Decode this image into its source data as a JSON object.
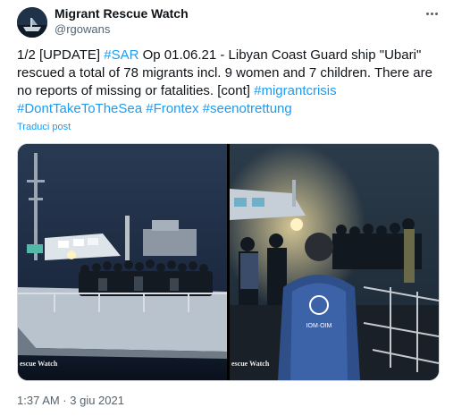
{
  "author": {
    "name": "Migrant Rescue Watch",
    "handle": "@rgowans",
    "avatar_icon": "boat-avatar-icon"
  },
  "post": {
    "text_plain_1": "1/2 [UPDATE] ",
    "tag_sar": "#SAR",
    "text_plain_2": " Op 01.06.21 - Libyan Coast Guard ship \"Ubari\" rescued a total of 78 migrants incl. 9 women and 7 children. There are no reports of missing or fatalities. [cont] ",
    "tag_migrantcrisis": "#migrantcrisis",
    "tag_donttake": "#DontTakeToTheSea",
    "tag_frontex": "#Frontex",
    "tag_seenot": "#seenotrettung",
    "translate_label": "Traduci post"
  },
  "media": {
    "photo1_watermark": "escue Watch",
    "photo2_watermark": "escue Watch",
    "vest_label": "IOM·OIM"
  },
  "timestamp": "1:37 AM · 3 giu 2021",
  "colors": {
    "link": "#1d9bf0",
    "secondary_text": "#536471",
    "primary_text": "#0f1419"
  }
}
